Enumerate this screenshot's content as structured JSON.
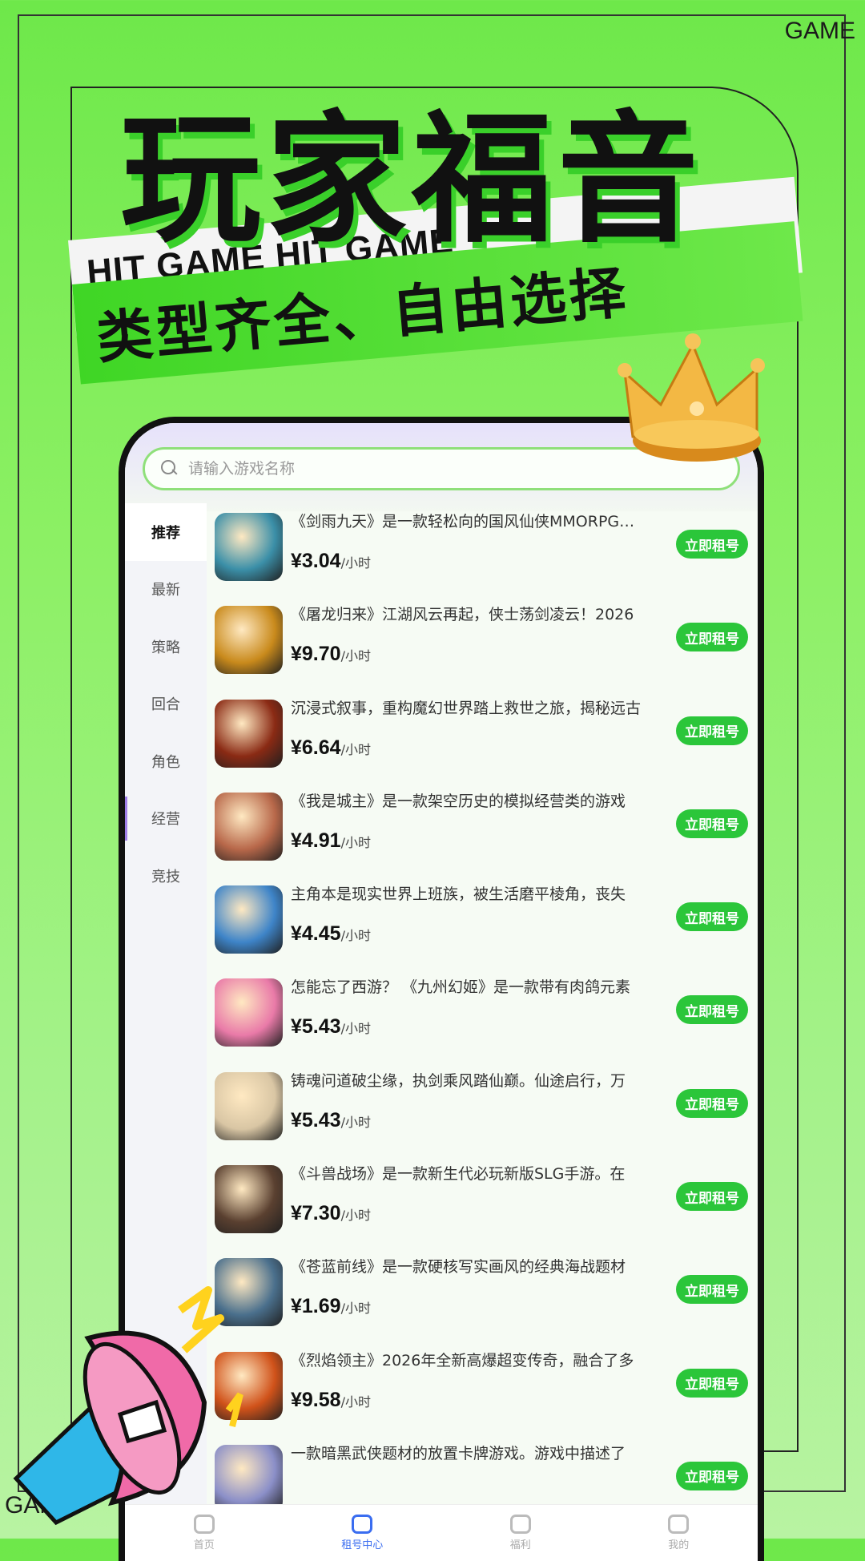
{
  "corner_labels": {
    "top_right": "GAME",
    "bottom_left": "GAME"
  },
  "headline": {
    "title": "玩家福音",
    "band_text_1": "HIT GAME  HIT GAME",
    "band_text_2": "GAME",
    "subtitle": "类型齐全、自由选择"
  },
  "search": {
    "placeholder": "请输入游戏名称"
  },
  "sidebar": {
    "items": [
      {
        "label": "推荐"
      },
      {
        "label": "最新"
      },
      {
        "label": "策略"
      },
      {
        "label": "回合"
      },
      {
        "label": "角色"
      },
      {
        "label": "经营"
      },
      {
        "label": "竞技"
      }
    ]
  },
  "games": [
    {
      "desc": "《剑雨九天》是一款轻松向的国风仙侠MMORPG手游",
      "price": "¥3.04",
      "unit": "/小时",
      "button": "立即租号",
      "thumb_color": "#3b8fa8"
    },
    {
      "desc": "《屠龙归来》江湖风云再起，侠士荡剑凌云！2026",
      "price": "¥9.70",
      "unit": "/小时",
      "button": "立即租号",
      "thumb_color": "#c98a1c"
    },
    {
      "desc": "沉浸式叙事，重构魔幻世界踏上救世之旅，揭秘远古",
      "price": "¥6.64",
      "unit": "/小时",
      "button": "立即租号",
      "thumb_color": "#8a2a14"
    },
    {
      "desc": "《我是城主》是一款架空历史的模拟经营类的游戏",
      "price": "¥4.91",
      "unit": "/小时",
      "button": "立即租号",
      "thumb_color": "#b8684a"
    },
    {
      "desc": "主角本是现实世界上班族，被生活磨平棱角，丧失",
      "price": "¥4.45",
      "unit": "/小时",
      "button": "立即租号",
      "thumb_color": "#3e84c8"
    },
    {
      "desc": "怎能忘了西游？ 《九州幻姬》是一款带有肉鸽元素",
      "price": "¥5.43",
      "unit": "/小时",
      "button": "立即租号",
      "thumb_color": "#e97aa8"
    },
    {
      "desc": "铸魂问道破尘缘，执剑乘风踏仙巅。仙途启行，万",
      "price": "¥5.43",
      "unit": "/小时",
      "button": "立即租号",
      "thumb_color": "#d9c6a4"
    },
    {
      "desc": "《斗兽战场》是一款新生代必玩新版SLG手游。在",
      "price": "¥7.30",
      "unit": "/小时",
      "button": "立即租号",
      "thumb_color": "#5a4030"
    },
    {
      "desc": "《苍蓝前线》是一款硬核写实画风的经典海战题材",
      "price": "¥1.69",
      "unit": "/小时",
      "button": "立即租号",
      "thumb_color": "#4a6f8c"
    },
    {
      "desc": "《烈焰领主》2026年全新高爆超变传奇，融合了多",
      "price": "¥9.58",
      "unit": "/小时",
      "button": "立即租号",
      "thumb_color": "#d0521a"
    },
    {
      "desc": "一款暗黑武侠题材的放置卡牌游戏。游戏中描述了",
      "price": "",
      "unit": "",
      "button": "立即租号",
      "thumb_color": "#8b8fc8"
    }
  ],
  "tabbar": [
    {
      "label": "首页"
    },
    {
      "label": "租号中心"
    },
    {
      "label": "福利"
    },
    {
      "label": "我的"
    }
  ],
  "colors": {
    "accent_green": "#2bc63a",
    "sidebar_marker": "#9f7de8",
    "active_tab": "#3a6df0"
  }
}
